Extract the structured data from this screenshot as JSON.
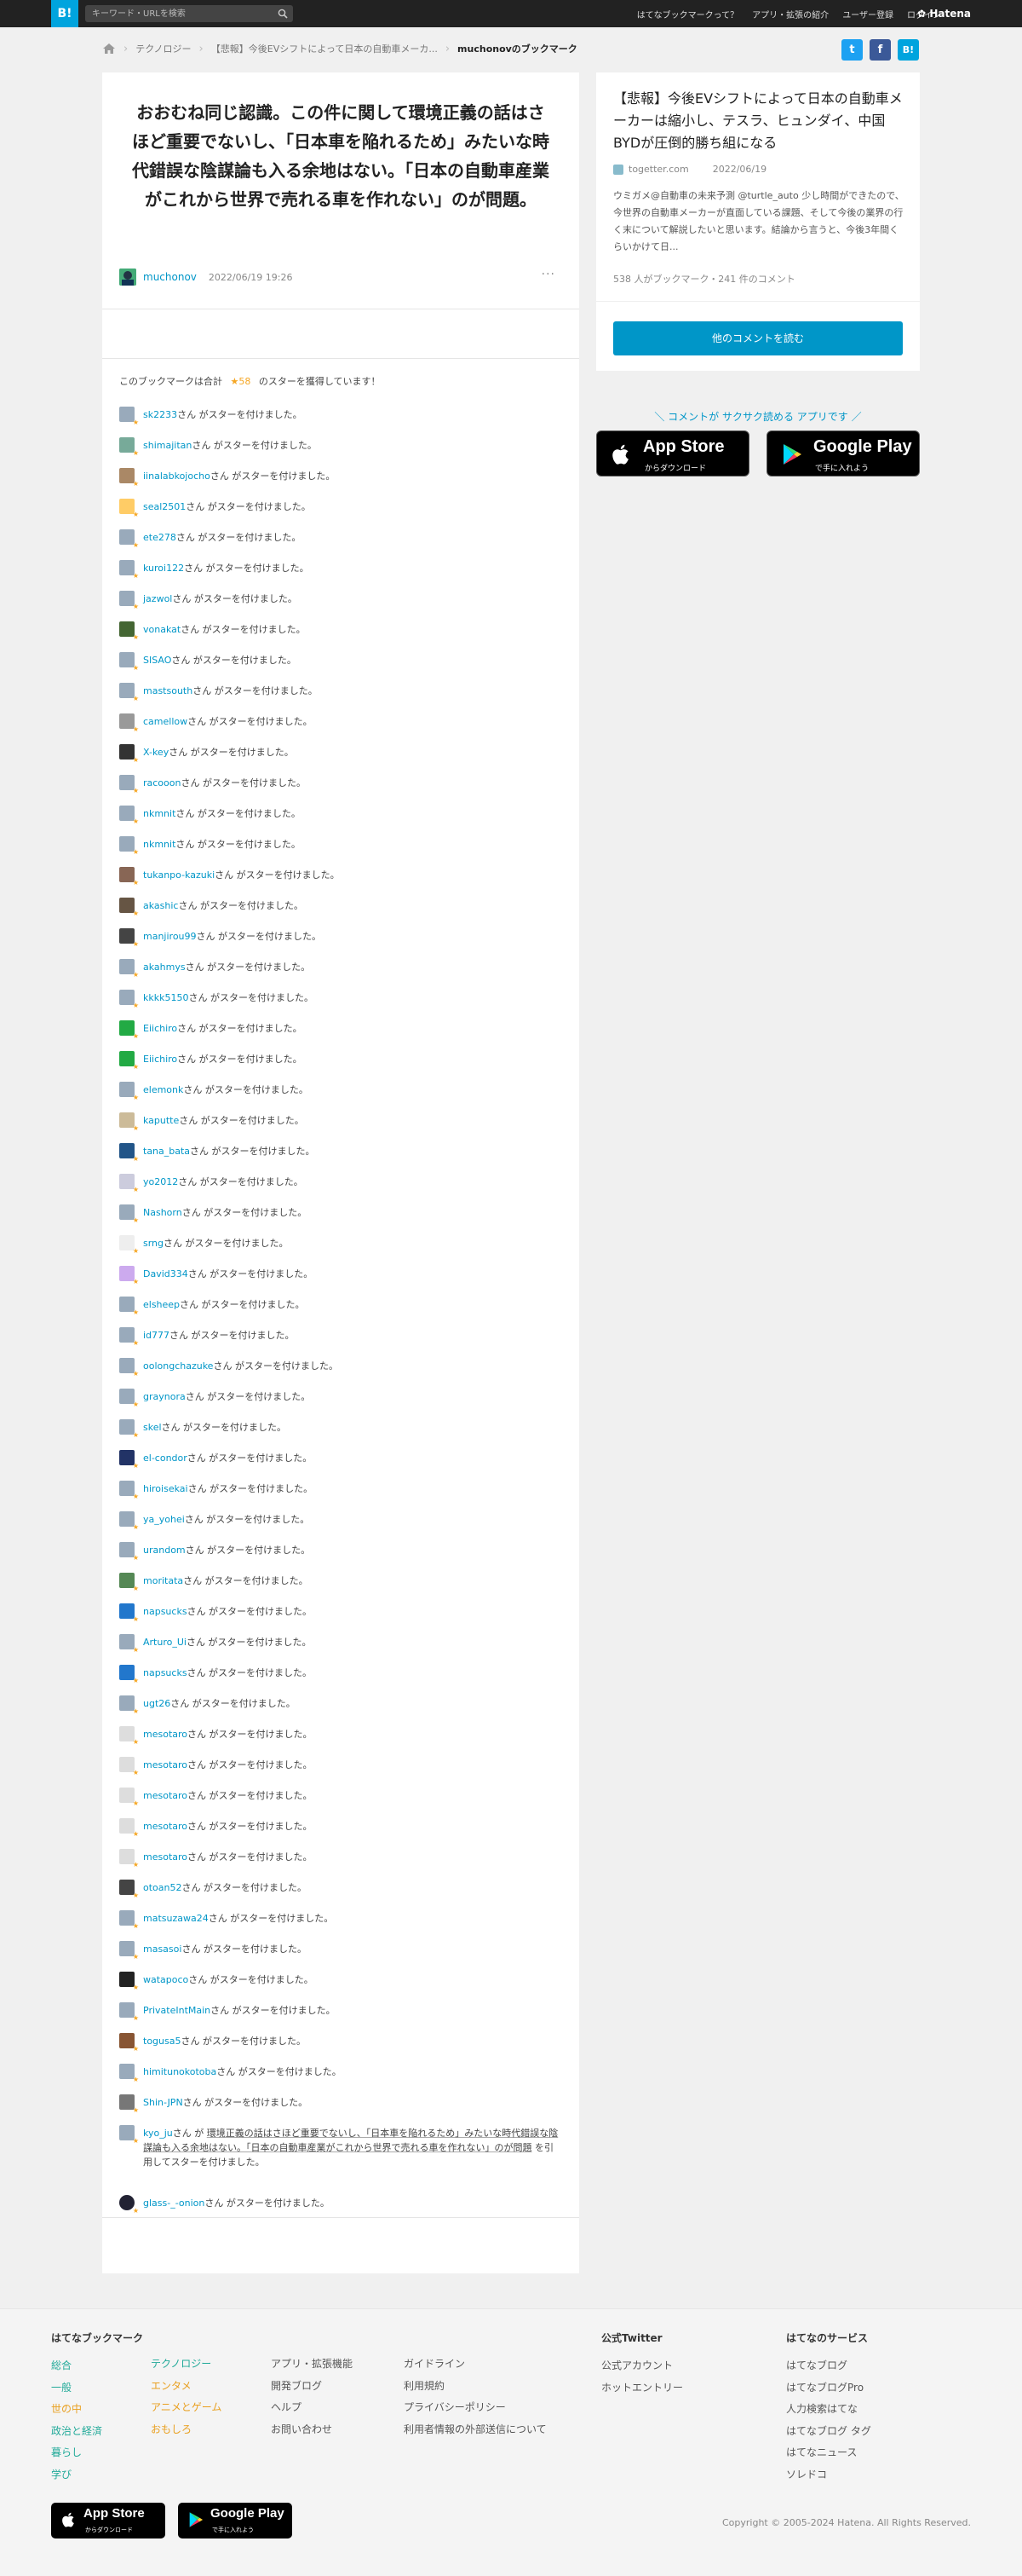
{
  "header": {
    "logo": "B!",
    "search_placeholder": "キーワード・URLを検索",
    "nav": [
      "はてなブックマークって？",
      "アプリ・拡張の紹介",
      "ユーザー登録",
      "ログイン"
    ],
    "brand": "Hatena"
  },
  "breadcrumb": {
    "items": [
      "テクノロジー",
      "【悲報】今後EVシフトによって日本の自動車メーカ...",
      "muchonovのブックマーク"
    ]
  },
  "share": {
    "twitter": "t",
    "facebook": "f",
    "hatena": "B!"
  },
  "bookmark": {
    "comment": "おおむね同じ認識。この件に関して環境正義の話はさほど重要でないし、「日本車を陥れるため」みたいな時代錯誤な陰謀論も入る余地はない。「日本の自動車産業がこれから世界で売れる車を作れない」のが問題。",
    "user": "muchonov",
    "date": "2022/06/19 19:26",
    "menu": "···",
    "star_summary_pre": "このブックマークは合計",
    "star_count": "★58",
    "star_summary_post": "のスターを獲得しています！"
  },
  "stars": [
    {
      "user": "sk2233",
      "text": "さん がスターを付けました。",
      "color": "#9ab"
    },
    {
      "user": "shimajitan",
      "text": "さん がスターを付けました。",
      "color": "#7a9"
    },
    {
      "user": "iinalabkojocho",
      "text": "さん がスターを付けました。",
      "color": "#a86"
    },
    {
      "user": "seal2501",
      "text": "さん がスターを付けました。",
      "color": "#fc6"
    },
    {
      "user": "ete278",
      "text": "さん がスターを付けました。",
      "color": "#9ab"
    },
    {
      "user": "kuroi122",
      "text": "さん がスターを付けました。",
      "color": "#9ab"
    },
    {
      "user": "jazwol",
      "text": "さん がスターを付けました。",
      "color": "#9ab"
    },
    {
      "user": "vonakat",
      "text": "さん がスターを付けました。",
      "color": "#463"
    },
    {
      "user": "SISAO",
      "text": "さん がスターを付けました。",
      "color": "#9ab"
    },
    {
      "user": "mastsouth",
      "text": "さん がスターを付けました。",
      "color": "#9ab"
    },
    {
      "user": "camellow",
      "text": "さん がスターを付けました。",
      "color": "#999"
    },
    {
      "user": "X-key",
      "text": "さん がスターを付けました。",
      "color": "#333"
    },
    {
      "user": "racooon",
      "text": "さん がスターを付けました。",
      "color": "#9ab"
    },
    {
      "user": "nkmnit",
      "text": "さん がスターを付けました。",
      "color": "#9ab"
    },
    {
      "user": "nkmnit",
      "text": "さん がスターを付けました。",
      "color": "#9ab"
    },
    {
      "user": "tukanpo-kazuki",
      "text": "さん がスターを付けました。",
      "color": "#865"
    },
    {
      "user": "akashic",
      "text": "さん がスターを付けました。",
      "color": "#654"
    },
    {
      "user": "manjirou99",
      "text": "さん がスターを付けました。",
      "color": "#444"
    },
    {
      "user": "akahmys",
      "text": "さん がスターを付けました。",
      "color": "#9ab"
    },
    {
      "user": "kkkk5150",
      "text": "さん がスターを付けました。",
      "color": "#9ab"
    },
    {
      "user": "Eiichiro",
      "text": "さん がスターを付けました。",
      "color": "#2a4"
    },
    {
      "user": "Eiichiro",
      "text": "さん がスターを付けました。",
      "color": "#2a4"
    },
    {
      "user": "elemonk",
      "text": "さん がスターを付けました。",
      "color": "#9ab"
    },
    {
      "user": "kaputte",
      "text": "さん がスターを付けました。",
      "color": "#cb9"
    },
    {
      "user": "tana_bata",
      "text": "さん がスターを付けました。",
      "color": "#258"
    },
    {
      "user": "yo2012",
      "text": "さん がスターを付けました。",
      "color": "#ccd"
    },
    {
      "user": "Nashorn",
      "text": "さん がスターを付けました。",
      "color": "#9ab"
    },
    {
      "user": "srng",
      "text": "さん がスターを付けました。",
      "color": "#eee"
    },
    {
      "user": "David334",
      "text": "さん がスターを付けました。",
      "color": "#cae"
    },
    {
      "user": "elsheep",
      "text": "さん がスターを付けました。",
      "color": "#9ab"
    },
    {
      "user": "id777",
      "text": "さん がスターを付けました。",
      "color": "#9ab"
    },
    {
      "user": "oolongchazuke",
      "text": "さん がスターを付けました。",
      "color": "#9ab"
    },
    {
      "user": "graynora",
      "text": "さん がスターを付けました。",
      "color": "#9ab"
    },
    {
      "user": "skel",
      "text": "さん がスターを付けました。",
      "color": "#9ab"
    },
    {
      "user": "el-condor",
      "text": "さん がスターを付けました。",
      "color": "#236"
    },
    {
      "user": "hiroisekai",
      "text": "さん がスターを付けました。",
      "color": "#9ab"
    },
    {
      "user": "ya_yohei",
      "text": "さん がスターを付けました。",
      "color": "#9ab"
    },
    {
      "user": "urandom",
      "text": "さん がスターを付けました。",
      "color": "#9ab"
    },
    {
      "user": "moritata",
      "text": "さん がスターを付けました。",
      "color": "#585"
    },
    {
      "user": "napsucks",
      "text": "さん がスターを付けました。",
      "color": "#27c"
    },
    {
      "user": "Arturo_Ui",
      "text": "さん がスターを付けました。",
      "color": "#9ab"
    },
    {
      "user": "napsucks",
      "text": "さん がスターを付けました。",
      "color": "#27c"
    },
    {
      "user": "ugt26",
      "text": "さん がスターを付けました。",
      "color": "#9ab"
    },
    {
      "user": "mesotaro",
      "text": "さん がスターを付けました。",
      "color": "#ddd"
    },
    {
      "user": "mesotaro",
      "text": "さん がスターを付けました。",
      "color": "#ddd"
    },
    {
      "user": "mesotaro",
      "text": "さん がスターを付けました。",
      "color": "#ddd"
    },
    {
      "user": "mesotaro",
      "text": "さん がスターを付けました。",
      "color": "#ddd"
    },
    {
      "user": "mesotaro",
      "text": "さん がスターを付けました。",
      "color": "#ddd"
    },
    {
      "user": "otoan52",
      "text": "さん がスターを付けました。",
      "color": "#444"
    },
    {
      "user": "matsuzawa24",
      "text": "さん がスターを付けました。",
      "color": "#9ab"
    },
    {
      "user": "masasoi",
      "text": "さん がスターを付けました。",
      "color": "#9ab"
    },
    {
      "user": "watapoco",
      "text": "さん がスターを付けました。",
      "color": "#222"
    },
    {
      "user": "PrivateIntMain",
      "text": "さん がスターを付けました。",
      "color": "#9ab"
    },
    {
      "user": "togusa5",
      "text": "さん がスターを付けました。",
      "color": "#853"
    },
    {
      "user": "himitunokotoba",
      "text": "さん がスターを付けました。",
      "color": "#9ab"
    },
    {
      "user": "Shin-JPN",
      "text": "さん がスターを付けました。",
      "color": "#777"
    }
  ],
  "quoted_star": {
    "user": "kyo_ju",
    "pre": "さん が",
    "quote": "環境正義の話はさほど重要でないし、「日本車を陥れるため」みたいな時代錯誤な陰謀論も入る余地はない。「日本の自動車産業がこれから世界で売れる車を作れない」のが問題",
    "post": "を引用してスターを付けました。",
    "color": "#9ab"
  },
  "last_star": {
    "user": "glass-_-onion",
    "text": "さん がスターを付けました。",
    "color": "#223"
  },
  "entry": {
    "title": "【悲報】今後EVシフトによって日本の自動車メーカーは縮小し、テスラ、ヒュンダイ、中国BYDが圧倒的勝ち組になる",
    "source": "togetter.com",
    "date": "2022/06/19",
    "description": "ウミガメ@自動車の未来予測 @turtle_auto 少し時間ができたので、今世界の自動車メーカーが直面している課題、そして今後の業界の行く末について解説したいと思います。結論から言うと、今後3年間くらいかけて日...",
    "meta": "538 人がブックマーク・241 件のコメント",
    "button": "他のコメントを読む"
  },
  "app_promo": {
    "message": "＼ コメントが サクサク読める アプリです ／",
    "appstore_big": "App Store",
    "appstore_small": "からダウンロード",
    "googleplay_big": "Google Play",
    "googleplay_small": "で手に入れよう"
  },
  "footer": {
    "col1": {
      "title": "はてなブックマーク",
      "items": [
        "総合",
        "一般",
        "世の中",
        "政治と経済",
        "暮らし",
        "学び"
      ]
    },
    "col2": {
      "items": [
        "テクノロジー",
        "エンタメ",
        "アニメとゲーム",
        "おもしろ"
      ]
    },
    "col3": {
      "items": [
        "アプリ・拡張機能",
        "開発ブログ",
        "ヘルプ",
        "お問い合わせ"
      ]
    },
    "col4": {
      "items": [
        "ガイドライン",
        "利用規約",
        "プライバシーポリシー",
        "利用者情報の外部送信について"
      ]
    },
    "col5": {
      "title": "公式Twitter",
      "items": [
        "公式アカウント",
        "ホットエントリー"
      ]
    },
    "col6": {
      "title": "はてなのサービス",
      "items": [
        "はてなブログ",
        "はてなブログPro",
        "人力検索はてな",
        "はてなブログ タグ",
        "はてなニュース",
        "ソレドコ"
      ]
    },
    "copyright": "Copyright © 2005-2024 Hatena. All Rights Reserved."
  },
  "colors": {
    "link": "#0096c8",
    "star": "#f5a623",
    "brand": "#00a4de",
    "footer_col1": "#2a9",
    "footer_col2": "#e9a020"
  }
}
